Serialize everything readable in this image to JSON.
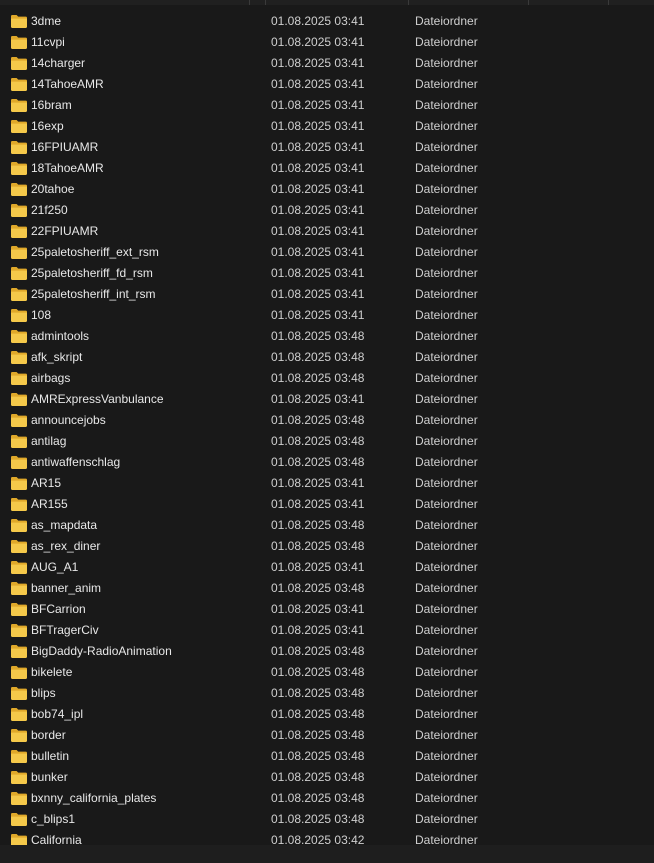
{
  "files": [
    {
      "name": "3dme",
      "date": "01.08.2025 03:41",
      "type": "Dateiordner"
    },
    {
      "name": "11cvpi",
      "date": "01.08.2025 03:41",
      "type": "Dateiordner"
    },
    {
      "name": "14charger",
      "date": "01.08.2025 03:41",
      "type": "Dateiordner"
    },
    {
      "name": "14TahoeAMR",
      "date": "01.08.2025 03:41",
      "type": "Dateiordner"
    },
    {
      "name": "16bram",
      "date": "01.08.2025 03:41",
      "type": "Dateiordner"
    },
    {
      "name": "16exp",
      "date": "01.08.2025 03:41",
      "type": "Dateiordner"
    },
    {
      "name": "16FPIUAMR",
      "date": "01.08.2025 03:41",
      "type": "Dateiordner"
    },
    {
      "name": "18TahoeAMR",
      "date": "01.08.2025 03:41",
      "type": "Dateiordner"
    },
    {
      "name": "20tahoe",
      "date": "01.08.2025 03:41",
      "type": "Dateiordner"
    },
    {
      "name": "21f250",
      "date": "01.08.2025 03:41",
      "type": "Dateiordner"
    },
    {
      "name": "22FPIUAMR",
      "date": "01.08.2025 03:41",
      "type": "Dateiordner"
    },
    {
      "name": "25paletosheriff_ext_rsm",
      "date": "01.08.2025 03:41",
      "type": "Dateiordner"
    },
    {
      "name": "25paletosheriff_fd_rsm",
      "date": "01.08.2025 03:41",
      "type": "Dateiordner"
    },
    {
      "name": "25paletosheriff_int_rsm",
      "date": "01.08.2025 03:41",
      "type": "Dateiordner"
    },
    {
      "name": "108",
      "date": "01.08.2025 03:41",
      "type": "Dateiordner"
    },
    {
      "name": "admintools",
      "date": "01.08.2025 03:48",
      "type": "Dateiordner"
    },
    {
      "name": "afk_skript",
      "date": "01.08.2025 03:48",
      "type": "Dateiordner"
    },
    {
      "name": "airbags",
      "date": "01.08.2025 03:48",
      "type": "Dateiordner"
    },
    {
      "name": "AMRExpressVanbulance",
      "date": "01.08.2025 03:41",
      "type": "Dateiordner"
    },
    {
      "name": "announcejobs",
      "date": "01.08.2025 03:48",
      "type": "Dateiordner"
    },
    {
      "name": "antilag",
      "date": "01.08.2025 03:48",
      "type": "Dateiordner"
    },
    {
      "name": "antiwaffenschlag",
      "date": "01.08.2025 03:48",
      "type": "Dateiordner"
    },
    {
      "name": "AR15",
      "date": "01.08.2025 03:41",
      "type": "Dateiordner"
    },
    {
      "name": "AR155",
      "date": "01.08.2025 03:41",
      "type": "Dateiordner"
    },
    {
      "name": "as_mapdata",
      "date": "01.08.2025 03:48",
      "type": "Dateiordner"
    },
    {
      "name": "as_rex_diner",
      "date": "01.08.2025 03:48",
      "type": "Dateiordner"
    },
    {
      "name": "AUG_A1",
      "date": "01.08.2025 03:41",
      "type": "Dateiordner"
    },
    {
      "name": "banner_anim",
      "date": "01.08.2025 03:48",
      "type": "Dateiordner"
    },
    {
      "name": "BFCarrion",
      "date": "01.08.2025 03:41",
      "type": "Dateiordner"
    },
    {
      "name": "BFTragerCiv",
      "date": "01.08.2025 03:41",
      "type": "Dateiordner"
    },
    {
      "name": "BigDaddy-RadioAnimation",
      "date": "01.08.2025 03:48",
      "type": "Dateiordner"
    },
    {
      "name": "bikelete",
      "date": "01.08.2025 03:48",
      "type": "Dateiordner"
    },
    {
      "name": "blips",
      "date": "01.08.2025 03:48",
      "type": "Dateiordner"
    },
    {
      "name": "bob74_ipl",
      "date": "01.08.2025 03:48",
      "type": "Dateiordner"
    },
    {
      "name": "border",
      "date": "01.08.2025 03:48",
      "type": "Dateiordner"
    },
    {
      "name": "bulletin",
      "date": "01.08.2025 03:48",
      "type": "Dateiordner"
    },
    {
      "name": "bunker",
      "date": "01.08.2025 03:48",
      "type": "Dateiordner"
    },
    {
      "name": "bxnny_california_plates",
      "date": "01.08.2025 03:48",
      "type": "Dateiordner"
    },
    {
      "name": "c_blips1",
      "date": "01.08.2025 03:48",
      "type": "Dateiordner"
    },
    {
      "name": "California",
      "date": "01.08.2025 03:42",
      "type": "Dateiordner"
    }
  ],
  "icons": {
    "row_icon": "folder-icon"
  },
  "colors": {
    "background": "#191919",
    "folder": "#f5c94a",
    "folder_tab": "#e0a92a",
    "text": "#e8e8e8"
  }
}
